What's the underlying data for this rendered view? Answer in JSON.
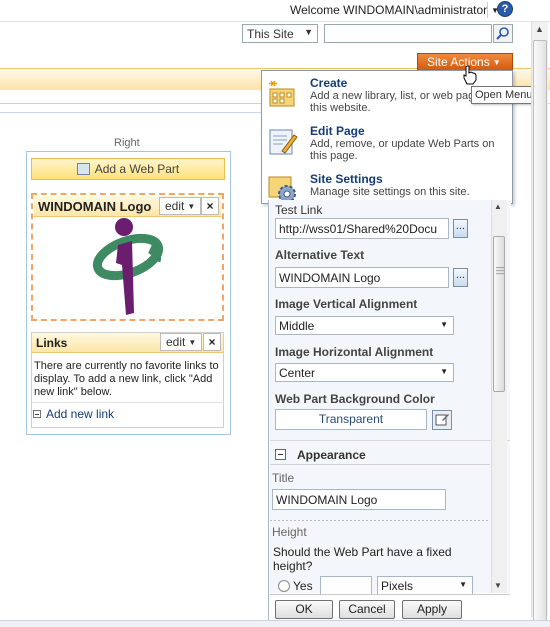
{
  "top": {
    "welcome_text": "Welcome WINDOMAIN\\administrator",
    "help_glyph": "?"
  },
  "search": {
    "scope_value": "This Site",
    "query_value": "",
    "icons": [
      "search-icon"
    ]
  },
  "site_actions": {
    "label": "Site Actions",
    "tooltip": "Open Menu",
    "menu_items": [
      {
        "title": "Create",
        "description": "Add a new library, list, or web page to this website.",
        "icon": "create-icon"
      },
      {
        "title": "Edit Page",
        "description": "Add, remove, or update Web Parts on this page.",
        "icon": "edit-page-icon"
      },
      {
        "title": "Site Settings",
        "description": "Manage site settings on this site.",
        "icon": "site-settings-icon"
      }
    ]
  },
  "zone": {
    "label": "Right",
    "add_web_part_label": "Add a Web Part"
  },
  "logo_part": {
    "title": "WINDOMAIN Logo",
    "edit_label": "edit",
    "close_glyph": "×"
  },
  "links_part": {
    "title": "Links",
    "edit_label": "edit",
    "close_glyph": "×",
    "empty_text": "There are currently no favorite links to display. To add a new link, click \"Add new link\" below.",
    "add_link_label": "Add new link"
  },
  "tool_pane": {
    "test_link_label": "Test Link",
    "test_link_value": "http://wss01/Shared%20Docu",
    "alt_text_label": "Alternative Text",
    "alt_text_value": "WINDOMAIN Logo",
    "vertical_align_label": "Image Vertical Alignment",
    "vertical_align_value": "Middle",
    "horizontal_align_label": "Image Horizontal Alignment",
    "horizontal_align_value": "Center",
    "bg_color_label": "Web Part Background Color",
    "bg_color_value": "Transparent",
    "appearance_label": "Appearance",
    "title_label": "Title",
    "title_value": "WINDOMAIN Logo",
    "height_label": "Height",
    "height_question": "Should the Web Part have a fixed height?",
    "yes_label": "Yes",
    "height_value": "",
    "height_units": "Pixels",
    "browse_glyph": "..."
  },
  "buttons": {
    "ok": "OK",
    "cancel": "Cancel",
    "apply": "Apply"
  },
  "colors": {
    "site_actions_bg": "#e06a1d",
    "menu_title": "#153c78",
    "webpart_header": "#fce6a8",
    "selected_border": "#f2a56b"
  }
}
